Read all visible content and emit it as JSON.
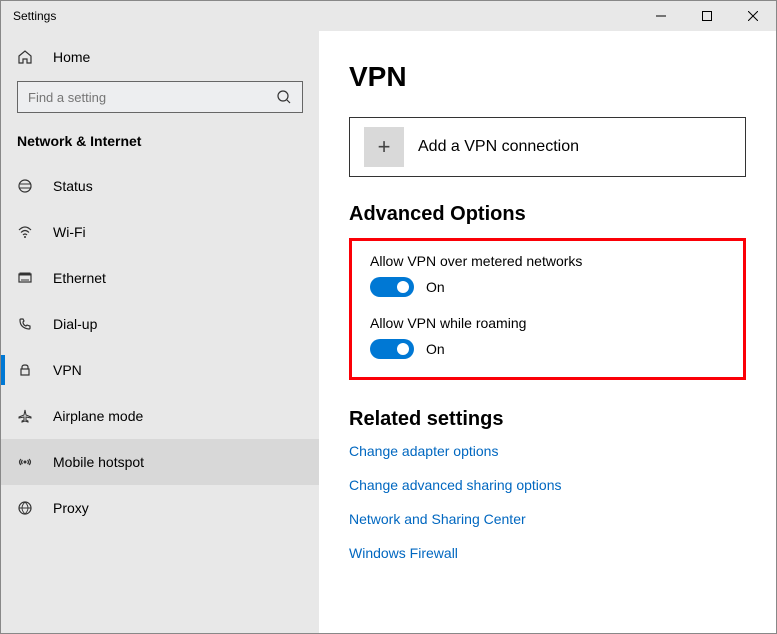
{
  "titlebar": {
    "title": "Settings"
  },
  "sidebar": {
    "home_label": "Home",
    "search_placeholder": "Find a setting",
    "section_label": "Network & Internet",
    "items": [
      {
        "label": "Status"
      },
      {
        "label": "Wi-Fi"
      },
      {
        "label": "Ethernet"
      },
      {
        "label": "Dial-up"
      },
      {
        "label": "VPN"
      },
      {
        "label": "Airplane mode"
      },
      {
        "label": "Mobile hotspot"
      },
      {
        "label": "Proxy"
      }
    ]
  },
  "main": {
    "page_title": "VPN",
    "add_connection_label": "Add a VPN connection",
    "advanced_heading": "Advanced Options",
    "opt_metered_label": "Allow VPN over metered networks",
    "opt_metered_state": "On",
    "opt_roaming_label": "Allow VPN while roaming",
    "opt_roaming_state": "On",
    "related_heading": "Related settings",
    "related_links": [
      "Change adapter options",
      "Change advanced sharing options",
      "Network and Sharing Center",
      "Windows Firewall"
    ]
  }
}
